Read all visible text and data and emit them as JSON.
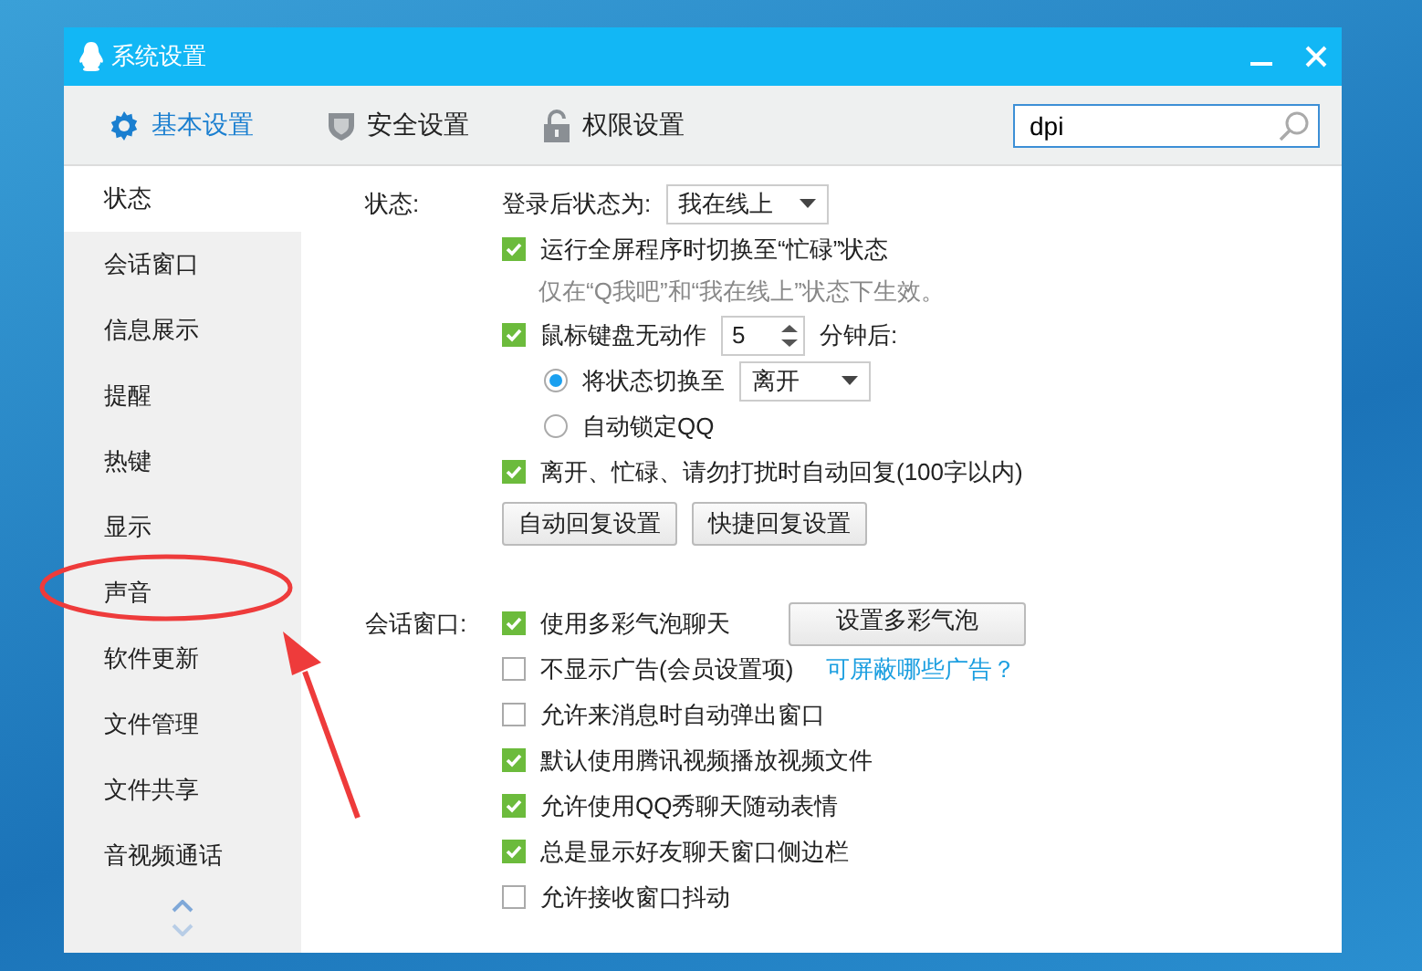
{
  "window": {
    "title": "系统设置"
  },
  "tabs": [
    {
      "label": "基本设置",
      "selected": true
    },
    {
      "label": "安全设置",
      "selected": false
    },
    {
      "label": "权限设置",
      "selected": false
    }
  ],
  "search": {
    "value": "dpi"
  },
  "sidebar": {
    "items": [
      {
        "label": "状态",
        "selected": true
      },
      {
        "label": "会话窗口",
        "selected": false
      },
      {
        "label": "信息展示",
        "selected": false
      },
      {
        "label": "提醒",
        "selected": false
      },
      {
        "label": "热键",
        "selected": false
      },
      {
        "label": "显示",
        "selected": false
      },
      {
        "label": "声音",
        "selected": false
      },
      {
        "label": "软件更新",
        "selected": false
      },
      {
        "label": "文件管理",
        "selected": false
      },
      {
        "label": "文件共享",
        "selected": false
      },
      {
        "label": "音视频通话",
        "selected": false
      }
    ]
  },
  "sections": [
    {
      "label": "状态:",
      "rows": [
        {
          "kind": "select",
          "label": "登录后状态为:",
          "value": "我在线上"
        },
        {
          "kind": "checkbox",
          "label": "运行全屏程序时切换至“忙碌”状态",
          "checked": true
        },
        {
          "kind": "note",
          "text": "仅在“Q我吧”和“我在线上”状态下生效。"
        },
        {
          "kind": "spinner",
          "label": "鼠标键盘无动作",
          "checked": true,
          "value": "5",
          "suffix": "分钟后:"
        },
        {
          "kind": "radio",
          "label": "将状态切换至",
          "selected": true,
          "value": "离开"
        },
        {
          "kind": "radio",
          "label": "自动锁定QQ",
          "selected": false
        },
        {
          "kind": "checkbox",
          "label": "离开、忙碌、请勿打扰时自动回复(100字以内)",
          "checked": true
        },
        {
          "kind": "buttons",
          "buttons": [
            "自动回复设置",
            "快捷回复设置"
          ]
        }
      ]
    },
    {
      "label": "会话窗口:",
      "rows": [
        {
          "kind": "checkbox",
          "label": "使用多彩气泡聊天",
          "checked": true,
          "button": "设置多彩气泡"
        },
        {
          "kind": "checkbox",
          "label": "不显示广告(会员设置项)",
          "checked": false,
          "link": "可屏蔽哪些广告？"
        },
        {
          "kind": "checkbox",
          "label": "允许来消息时自动弹出窗口",
          "checked": false
        },
        {
          "kind": "checkbox",
          "label": "默认使用腾讯视频播放视频文件",
          "checked": true
        },
        {
          "kind": "checkbox",
          "label": "允许使用QQ秀聊天随动表情",
          "checked": true
        },
        {
          "kind": "checkbox",
          "label": "总是显示好友聊天窗口侧边栏",
          "checked": true
        },
        {
          "kind": "checkbox",
          "label": "允许接收窗口抖动",
          "checked": false
        }
      ]
    }
  ]
}
